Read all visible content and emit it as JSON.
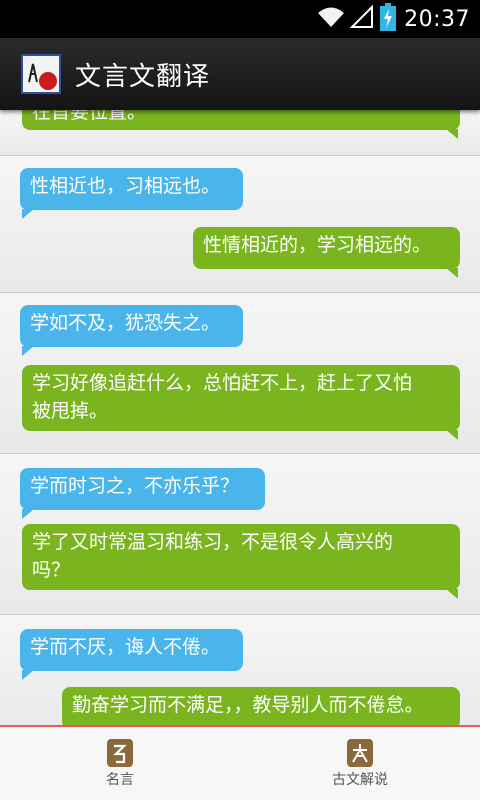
{
  "status_bar": {
    "time": "20:37"
  },
  "action_bar": {
    "title": "文言文翻译"
  },
  "groups": [
    {
      "answer": "在首要位置。"
    },
    {
      "question": "性相近也，习相远也。",
      "answer": "性情相近的，学习相远的。"
    },
    {
      "question": "学如不及，犹恐失之。",
      "answer_line1": "学习好像追赶什么，总怕赶不上，赶上了又怕",
      "answer_line2": "被甩掉。"
    },
    {
      "question": "学而时习之，不亦乐乎？",
      "answer_line1": "学了又时常温习和练习，不是很令人高兴的",
      "answer_line2": "吗？"
    },
    {
      "question": "学而不厌，诲人不倦。",
      "answer": "勤奋学习而不满足，，教导别人而不倦怠。"
    }
  ],
  "bottom_nav": {
    "tab1_label": "名言",
    "tab2_label": "古文解说"
  }
}
